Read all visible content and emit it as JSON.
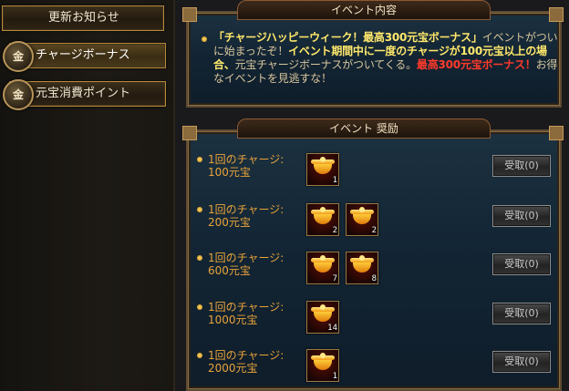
{
  "sidebar": {
    "items": [
      {
        "label": "更新お知らせ",
        "active": false
      },
      {
        "label": "チャージボーナス",
        "active": true,
        "badge": "金"
      },
      {
        "label": "元宝消費ポイント",
        "active": false,
        "badge": "金"
      }
    ]
  },
  "event_info": {
    "title": "イベント内容",
    "segments": [
      {
        "text": "「チャージハッピーウィーク！最高300元宝ボーナス」",
        "style": "highlight-yellow"
      },
      {
        "text": "イベントがついに始まったぞ！",
        "style": "normal"
      },
      {
        "text": "イベント期間中に一度のチャージが100元宝以上の場合、",
        "style": "highlight-yellow"
      },
      {
        "text": "元宝チャージボーナスがついてくる。",
        "style": "normal"
      },
      {
        "text": "最高300元宝ボーナス！",
        "style": "highlight-red"
      },
      {
        "text": "お得なイベントを見逃すな！",
        "style": "normal"
      }
    ]
  },
  "rewards": {
    "title": "イベント 奨励",
    "rows": [
      {
        "line1": "1回のチャージ:",
        "line2": "100元宝",
        "items": [
          {
            "icon": "gold-ingot-icon",
            "count": "1"
          }
        ],
        "claim_label": "受取(0)"
      },
      {
        "line1": "1回のチャージ:",
        "line2": "200元宝",
        "items": [
          {
            "icon": "gold-ingot-icon",
            "count": "2"
          },
          {
            "icon": "gold-ingot-icon",
            "count": "2"
          }
        ],
        "claim_label": "受取(0)"
      },
      {
        "line1": "1回のチャージ:",
        "line2": "600元宝",
        "items": [
          {
            "icon": "gold-ingot-icon",
            "count": "7"
          },
          {
            "icon": "gold-ingot-icon",
            "count": "8"
          }
        ],
        "claim_label": "受取(0)"
      },
      {
        "line1": "1回のチャージ:",
        "line2": "1000元宝",
        "items": [
          {
            "icon": "gold-ingot-icon",
            "count": "14"
          }
        ],
        "claim_label": "受取(0)"
      },
      {
        "line1": "1回のチャージ:",
        "line2": "2000元宝",
        "items": [
          {
            "icon": "gold-ingot-icon",
            "count": "1"
          }
        ],
        "claim_label": "受取(0)"
      }
    ]
  },
  "colors": {
    "accent_gold": "#e8a33a",
    "highlight_yellow": "#ffe86b",
    "highlight_red": "#ff3a2b",
    "panel_blue": "#122433"
  }
}
